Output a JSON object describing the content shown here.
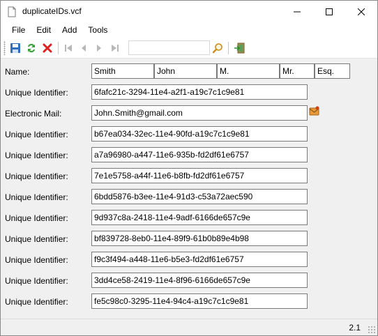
{
  "window": {
    "title": "duplicateIDs.vcf"
  },
  "menu": {
    "items": [
      "File",
      "Edit",
      "Add",
      "Tools"
    ]
  },
  "toolbar": {
    "search_value": "",
    "icons": [
      "save-icon",
      "refresh-icon",
      "delete-icon",
      "first-record-icon",
      "previous-record-icon",
      "next-record-icon",
      "last-record-icon",
      "search-icon",
      "exit-icon"
    ]
  },
  "form": {
    "name_label": "Name:",
    "name_parts": [
      "Smith",
      "John",
      "M.",
      "Mr.",
      "Esq."
    ],
    "rows": [
      {
        "label": "Unique Identifier:",
        "value": "6fafc21c-3294-11e4-a2f1-a19c7c1c9e81"
      },
      {
        "label": "Electronic Mail:",
        "value": "John.Smith@gmail.com"
      },
      {
        "label": "Unique Identifier:",
        "value": "b67ea034-32ec-11e4-90fd-a19c7c1c9e81"
      },
      {
        "label": "Unique Identifier:",
        "value": "a7a96980-a447-11e6-935b-fd2df61e6757"
      },
      {
        "label": "Unique Identifier:",
        "value": "7e1e5758-a44f-11e6-b8fb-fd2df61e6757"
      },
      {
        "label": "Unique Identifier:",
        "value": "6bdd5876-b3ee-11e4-91d3-c53a72aec590"
      },
      {
        "label": "Unique Identifier:",
        "value": "9d937c8a-2418-11e4-9adf-6166de657c9e"
      },
      {
        "label": "Unique Identifier:",
        "value": "bf839728-8eb0-11e4-89f9-61b0b89e4b98"
      },
      {
        "label": "Unique Identifier:",
        "value": "f9c3f494-a448-11e6-b5e3-fd2df61e6757"
      },
      {
        "label": "Unique Identifier:",
        "value": "3dd4ce58-2419-11e4-8f96-6166de657c9e"
      },
      {
        "label": "Unique Identifier:",
        "value": "fe5c98c0-3295-11e4-94c4-a19c7c1c9e81"
      }
    ]
  },
  "status": {
    "version": "2.1"
  },
  "colors": {
    "save": "#2e6fc0",
    "refresh": "#3aa23a",
    "delete": "#e02020",
    "nav_disabled": "#b8b8b8",
    "search": "#d08a10"
  }
}
